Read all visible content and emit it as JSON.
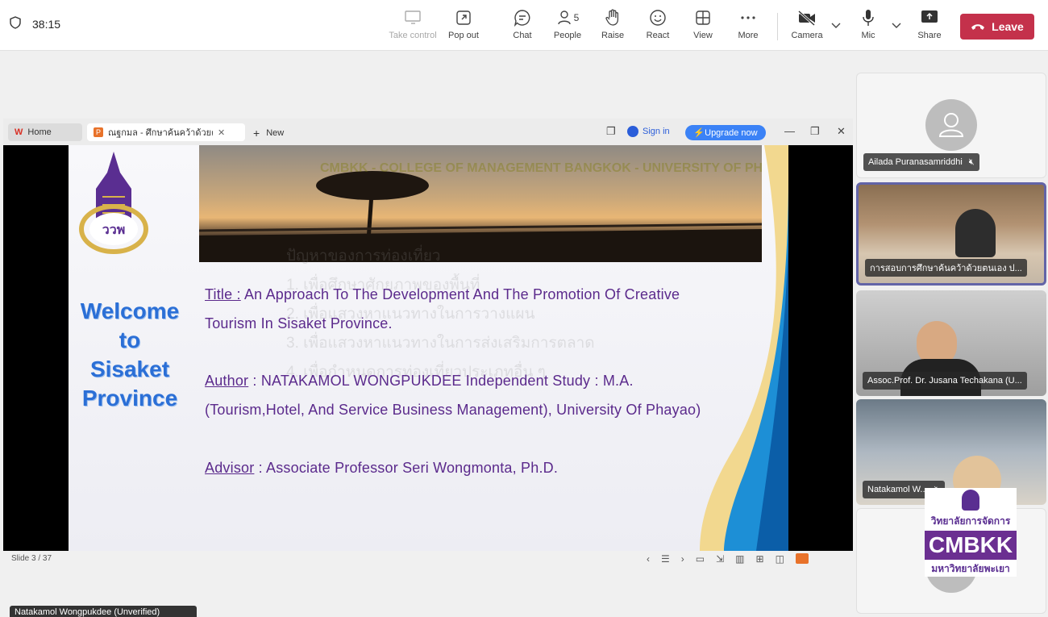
{
  "meeting": {
    "timer": "38:15",
    "toolbar": {
      "take_control": "Take control",
      "pop_out": "Pop out",
      "chat": "Chat",
      "people": "People",
      "people_count": "5",
      "raise": "Raise",
      "react": "React",
      "view": "View",
      "more": "More",
      "camera": "Camera",
      "mic": "Mic",
      "share": "Share",
      "leave": "Leave"
    }
  },
  "browser": {
    "home_tab": "Home",
    "doc_tab": "ณฐกมล - ศึกษาค้นคว้าด้วยตัวเอ",
    "new_tab": "New",
    "sign_in": "Sign in",
    "upgrade": "Upgrade now"
  },
  "slide": {
    "banner_text": "CMBKK - COLLEGE OF MANAGEMENT BANGKOK - UNIVERSITY OF PHAYAO",
    "welcome": [
      "Welcome",
      "to",
      "Sisaket",
      "Province"
    ],
    "title_label": "Title :",
    "title_line1": " An Approach To The Development And The Promotion Of Creative",
    "title_line2": "Tourism In Sisaket Province.",
    "author_label": "Author",
    "author_line1": " : NATAKAMOL  WONGPUKDEE Independent Study : M.A.",
    "author_line2": "(Tourism,Hotel, And Service Business Management), University Of Phayao)",
    "advisor_label": "Advisor",
    "advisor_line": " : Associate Professor Seri Wongmonta, Ph.D.",
    "slide_number": "Slide 3 / 37"
  },
  "participants": [
    {
      "name": "Ailada Puranasamriddhi",
      "muted": true
    },
    {
      "name": "การสอบการศึกษาค้นคว้าด้วยตนเอง ป..."
    },
    {
      "name": "Assoc.Prof. Dr. Jusana Techakana (U..."
    },
    {
      "name": "Natakamol W...",
      "muted": true
    }
  ],
  "bottom_label": "Natakamol Wongpukdee (Unverified)",
  "cmbkk": {
    "line1": "วิทยาลัยการจัดการ",
    "brand": "CMBKK",
    "line2": "มหาวิทยาลัยพะเยา"
  },
  "colors": {
    "leave": "#c4314b",
    "slide_text": "#5b2a8c",
    "welcome": "#2b6fd6",
    "upgrade": "#3b82f6"
  }
}
